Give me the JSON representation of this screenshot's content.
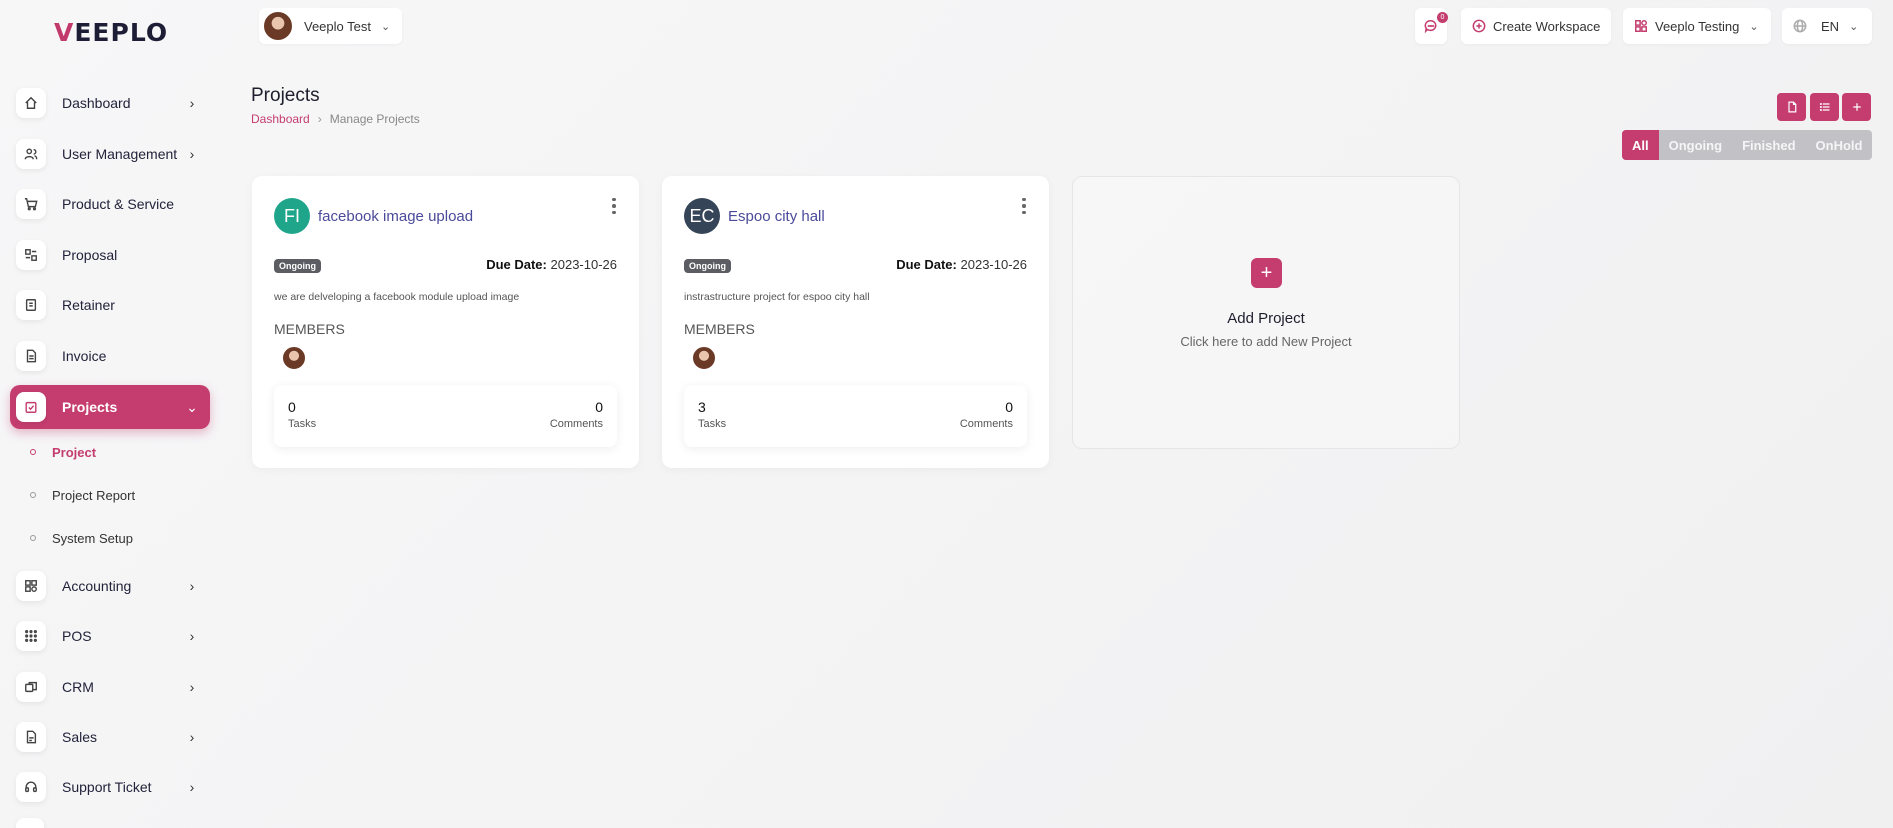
{
  "app": {
    "logo": "VEEPLO",
    "logo_first": "V",
    "logo_rest": "EEPLO"
  },
  "colors": {
    "accent": "#c43d6e",
    "fi_avatar": "#1fa68a",
    "ec_avatar": "#364457"
  },
  "header": {
    "user_name": "Veeplo Test",
    "notification_count": "0",
    "create_workspace": "Create Workspace",
    "workspace": "Veeplo Testing",
    "language": "EN"
  },
  "sidebar": {
    "items": [
      {
        "label": "Dashboard",
        "icon": "home-icon"
      },
      {
        "label": "User Management",
        "icon": "users-icon"
      },
      {
        "label": "Product & Service",
        "icon": "cart-icon"
      },
      {
        "label": "Proposal",
        "icon": "proposal-icon"
      },
      {
        "label": "Retainer",
        "icon": "retainer-icon"
      },
      {
        "label": "Invoice",
        "icon": "invoice-icon"
      },
      {
        "label": "Projects",
        "icon": "projects-icon"
      },
      {
        "label": "Accounting",
        "icon": "accounting-icon"
      },
      {
        "label": "POS",
        "icon": "pos-icon"
      },
      {
        "label": "CRM",
        "icon": "crm-icon"
      },
      {
        "label": "Sales",
        "icon": "sales-icon"
      },
      {
        "label": "Support Ticket",
        "icon": "headset-icon"
      }
    ],
    "sub_items": [
      {
        "label": "Project"
      },
      {
        "label": "Project Report"
      },
      {
        "label": "System Setup"
      }
    ]
  },
  "page": {
    "title": "Projects",
    "breadcrumb": {
      "home": "Dashboard",
      "separator": "›",
      "current": "Manage Projects"
    },
    "filters": [
      "All",
      "Ongoing",
      "Finished",
      "OnHold"
    ],
    "actions": [
      "export-icon",
      "list-icon",
      "plus-icon"
    ]
  },
  "projects": [
    {
      "initials": "FI",
      "name": "facebook image upload",
      "status": "Ongoing",
      "due_label": "Due Date:",
      "due_date": "2023-10-26",
      "description": "we are delveloping a facebook module upload image",
      "members_label": "MEMBERS",
      "tasks": "0",
      "tasks_label": "Tasks",
      "comments": "0",
      "comments_label": "Comments"
    },
    {
      "initials": "EC",
      "name": "Espoo city hall",
      "status": "Ongoing",
      "due_label": "Due Date:",
      "due_date": "2023-10-26",
      "description": "instrastructure project for espoo city hall",
      "members_label": "MEMBERS",
      "tasks": "3",
      "tasks_label": "Tasks",
      "comments": "0",
      "comments_label": "Comments"
    }
  ],
  "add_project": {
    "plus": "+",
    "title": "Add Project",
    "subtitle": "Click here to add New Project"
  }
}
